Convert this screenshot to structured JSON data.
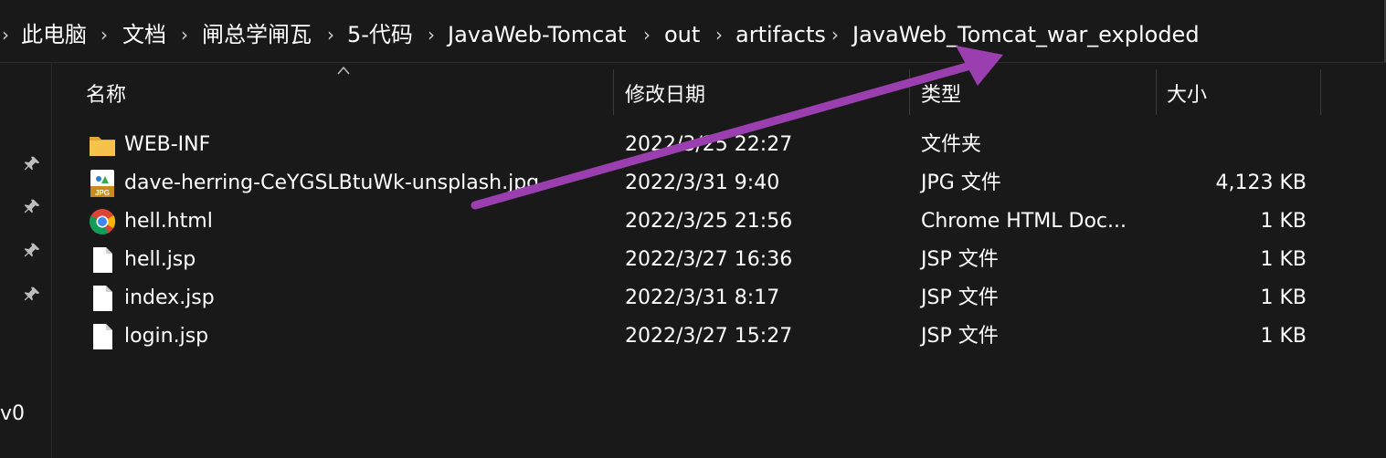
{
  "breadcrumb": {
    "items": [
      "此电脑",
      "文档",
      "闸总学闸瓦",
      "5-代码",
      "JavaWeb-Tomcat",
      "out",
      "artifacts",
      "JavaWeb_Tomcat_war_exploded"
    ]
  },
  "nav": {
    "partial_label": "v0"
  },
  "columns": {
    "name": "名称",
    "date": "修改日期",
    "type": "类型",
    "size": "大小"
  },
  "files": [
    {
      "name": "WEB-INF",
      "date": "2022/3/25 22:27",
      "type": "文件夹",
      "size": "",
      "icon": "folder-icon"
    },
    {
      "name": "dave-herring-CeYGSLBtuWk-unsplash.jpg",
      "date": "2022/3/31 9:40",
      "type": "JPG 文件",
      "size": "4,123 KB",
      "icon": "jpg-file-icon"
    },
    {
      "name": "hell.html",
      "date": "2022/3/25 21:56",
      "type": "Chrome HTML Doc...",
      "size": "1 KB",
      "icon": "chrome-icon"
    },
    {
      "name": "hell.jsp",
      "date": "2022/3/27 16:36",
      "type": "JSP 文件",
      "size": "1 KB",
      "icon": "file-icon"
    },
    {
      "name": "index.jsp",
      "date": "2022/3/31 8:17",
      "type": "JSP 文件",
      "size": "1 KB",
      "icon": "file-icon"
    },
    {
      "name": "login.jsp",
      "date": "2022/3/27 15:27",
      "type": "JSP 文件",
      "size": "1 KB",
      "icon": "file-icon"
    }
  ],
  "colors": {
    "background": "#191919",
    "annotation_arrow": "#9b3fb0",
    "folder": "#f5c24c"
  }
}
